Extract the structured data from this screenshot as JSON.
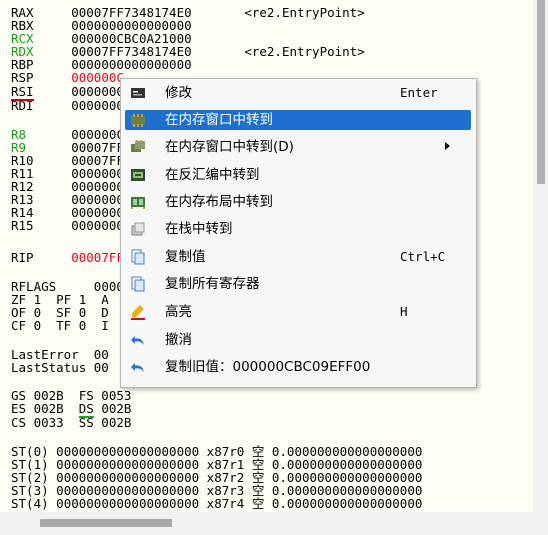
{
  "registers": [
    {
      "name": "RAX",
      "value": "00007FF7348174E0",
      "comment": "<re2.EntryPoint>"
    },
    {
      "name": "RBX",
      "value": "0000000000000000",
      "comment": ""
    },
    {
      "name": "RCX",
      "value": "000000CBC0A21000",
      "comment": ""
    },
    {
      "name": "RDX",
      "value": "00007FF7348174E0",
      "comment": "<re2.EntryPoint>"
    },
    {
      "name": "RBP",
      "value": "0000000000000000",
      "comment": ""
    },
    {
      "name": "RSP",
      "value": "000000C",
      "comment": ""
    },
    {
      "name": "RSI",
      "value": "0000000",
      "comment": ""
    },
    {
      "name": "RDI",
      "value": "0000000",
      "comment": ""
    },
    {
      "name": "R8",
      "value": "000000C",
      "comment": ""
    },
    {
      "name": "R9",
      "value": "00007FF",
      "comment": ""
    },
    {
      "name": "R10",
      "value": "00007FF",
      "comment": ""
    },
    {
      "name": "R11",
      "value": "0000000",
      "comment": ""
    },
    {
      "name": "R12",
      "value": "0000000",
      "comment": ""
    },
    {
      "name": "R13",
      "value": "0000000",
      "comment": ""
    },
    {
      "name": "R14",
      "value": "0000000",
      "comment": ""
    },
    {
      "name": "R15",
      "value": "0000000",
      "comment": ""
    },
    {
      "name": "RIP",
      "value": "00007FF",
      "comment": ""
    }
  ],
  "flags": {
    "label": "RFLAGS",
    "value": "0000",
    "line1": "ZF 1  PF 1  A",
    "line2": "OF 0  SF 0  D",
    "line3": "CF 0  TF 0  I"
  },
  "errors": {
    "last_error": "LastError  00",
    "last_status": "LastStatus 00"
  },
  "segments": {
    "gs": "GS 002B  FS 0053",
    "es_a": "ES 002B  ",
    "es_ds": "DS",
    "es_b": " 002B",
    "cs": "CS 0033  SS 002B"
  },
  "fpu": [
    {
      "name": "ST(0)",
      "value": "0000000000000000000 x87r0 空 0.000000000000000000"
    },
    {
      "name": "ST(1)",
      "value": "0000000000000000000 x87r1 空 0.000000000000000000"
    },
    {
      "name": "ST(2)",
      "value": "0000000000000000000 x87r2 空 0.000000000000000000"
    },
    {
      "name": "ST(3)",
      "value": "0000000000000000000 x87r3 空 0.000000000000000000"
    },
    {
      "name": "ST(4)",
      "value": "0000000000000000000 x87r4 空 0.000000000000000000"
    }
  ],
  "menu": {
    "items": [
      {
        "label": "修改",
        "shortcut": "Enter",
        "icon": "edit-icon"
      },
      {
        "label": "在内存窗口中转到",
        "shortcut": "",
        "icon": "dump-icon"
      },
      {
        "label": "在内存窗口中转到(D)",
        "shortcut": "",
        "icon": "dump-multi-icon"
      },
      {
        "label": "在反汇编中转到",
        "shortcut": "",
        "icon": "disassembly-icon"
      },
      {
        "label": "在内存布局中转到",
        "shortcut": "",
        "icon": "memory-map-icon"
      },
      {
        "label": "在栈中转到",
        "shortcut": "",
        "icon": "stack-icon"
      },
      {
        "label": "复制值",
        "shortcut": "Ctrl+C",
        "icon": "copy-icon"
      },
      {
        "label": "复制所有寄存器",
        "shortcut": "",
        "icon": "copy-all-icon"
      },
      {
        "label": "高亮",
        "shortcut": "H",
        "icon": "highlight-icon"
      },
      {
        "label": "撤消",
        "shortcut": "",
        "icon": "undo-icon"
      },
      {
        "label": "复制旧值：000000CBC09EFF00",
        "shortcut": "",
        "icon": "copy-old-icon"
      }
    ]
  },
  "colors": {
    "accent": "#1f6fd0",
    "modified": "#e8001c",
    "rcx_rdx": "#16a016"
  }
}
